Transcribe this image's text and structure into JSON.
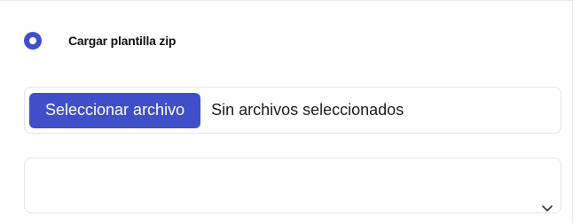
{
  "upload_option": {
    "label": "Cargar plantilla zip",
    "selected": true
  },
  "file_input": {
    "button_label": "Seleccionar archivo",
    "status_text": "Sin archivos seleccionados"
  },
  "select": {
    "value": "",
    "icon": "chevron-down-icon"
  },
  "colors": {
    "accent": "#3f4ec9",
    "border": "#e3e3e6",
    "text": "#1c1c1c"
  }
}
